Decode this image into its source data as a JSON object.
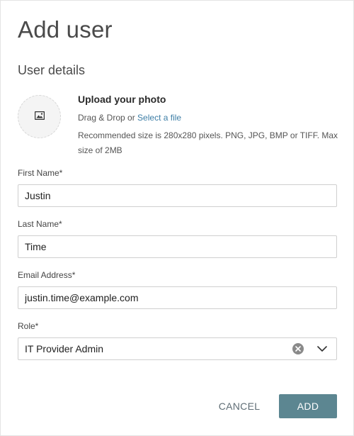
{
  "dialog": {
    "title": "Add user",
    "section_title": "User details"
  },
  "upload": {
    "title": "Upload your photo",
    "drag_text": "Drag & Drop or",
    "select_link": "Select a file",
    "note": "Recommended size is 280x280 pixels. PNG, JPG, BMP or TIFF. Max size of 2MB",
    "icon": "image-icon"
  },
  "fields": {
    "first_name": {
      "label": "First Name*",
      "value": "Justin"
    },
    "last_name": {
      "label": "Last Name*",
      "value": "Time"
    },
    "email": {
      "label": "Email Address*",
      "value": "justin.time@example.com"
    },
    "role": {
      "label": "Role*",
      "value": "IT Provider Admin"
    }
  },
  "actions": {
    "cancel_label": "CANCEL",
    "add_label": "ADD"
  },
  "colors": {
    "add_button": "#5c8691",
    "link": "#3d7ea6",
    "clear_icon": "#8a8a8a"
  }
}
